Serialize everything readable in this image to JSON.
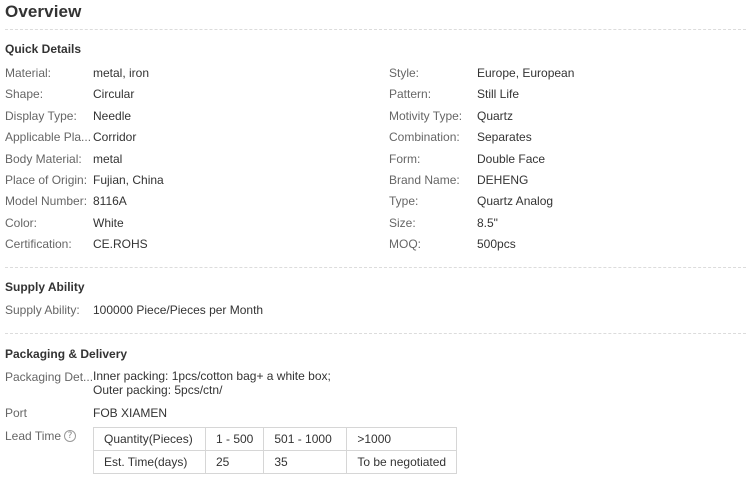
{
  "overview": {
    "title": "Overview"
  },
  "quick_details": {
    "title": "Quick Details",
    "left": [
      {
        "label": "Material:",
        "value": "metal, iron"
      },
      {
        "label": "Shape:",
        "value": "Circular"
      },
      {
        "label": "Display Type:",
        "value": "Needle"
      },
      {
        "label": "Applicable Pla...",
        "value": "Corridor"
      },
      {
        "label": "Body Material:",
        "value": "metal"
      },
      {
        "label": "Place of Origin:",
        "value": "Fujian, China"
      },
      {
        "label": "Model Number:",
        "value": "8116A"
      },
      {
        "label": "Color:",
        "value": "White"
      },
      {
        "label": "Certification:",
        "value": "CE.ROHS"
      }
    ],
    "right": [
      {
        "label": "Style:",
        "value": "Europe, European"
      },
      {
        "label": "Pattern:",
        "value": "Still Life"
      },
      {
        "label": "Motivity Type:",
        "value": "Quartz"
      },
      {
        "label": "Combination:",
        "value": "Separates"
      },
      {
        "label": "Form:",
        "value": "Double Face"
      },
      {
        "label": "Brand Name:",
        "value": "DEHENG"
      },
      {
        "label": "Type:",
        "value": "Quartz Analog"
      },
      {
        "label": "Size:",
        "value": "8.5\""
      },
      {
        "label": "MOQ:",
        "value": "500pcs"
      }
    ]
  },
  "supply_ability": {
    "title": "Supply Ability",
    "label": "Supply Ability:",
    "value": "100000 Piece/Pieces per Month"
  },
  "packaging": {
    "title": "Packaging & Delivery",
    "details_label": "Packaging Det...",
    "details_line1": "Inner packing: 1pcs/cotton bag+ a white box;",
    "details_line2": "Outer packing: 5pcs/ctn/",
    "port_label": "Port",
    "port_value": "FOB XIAMEN",
    "lead_time_label": "Lead Time",
    "help_icon_glyph": "?",
    "lead_table": [
      [
        "Quantity(Pieces)",
        "1 - 500",
        "501 - 1000",
        ">1000"
      ],
      [
        "Est. Time(days)",
        "25",
        "35",
        "To be negotiated"
      ]
    ]
  }
}
